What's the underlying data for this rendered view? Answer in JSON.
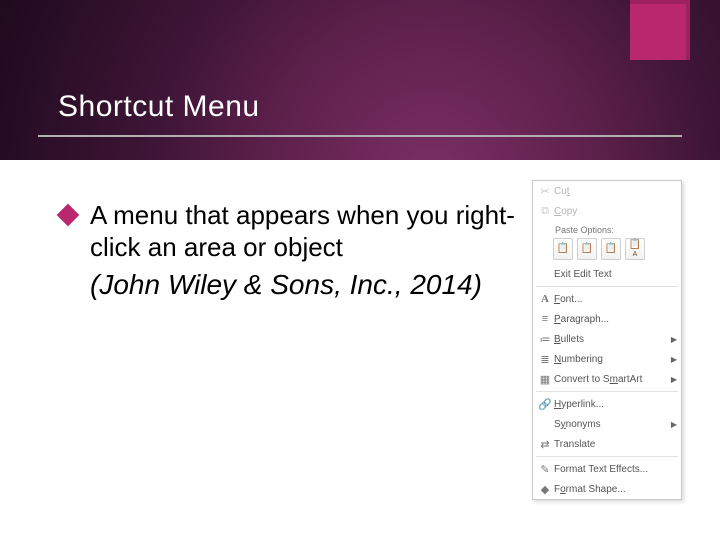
{
  "header": {
    "title": "Shortcut Menu"
  },
  "body": {
    "bullet_text": "A menu that appears when you right-click an area or object",
    "citation": "(John Wiley & Sons, Inc., 2014)"
  },
  "context_menu": {
    "paste_options_label": "Paste Options:",
    "paste_buttons": [
      "keep-source",
      "merge",
      "picture",
      "text-only"
    ],
    "items": [
      {
        "icon": "✂",
        "label": "Cut",
        "underline": "t",
        "enabled": false,
        "submenu": false
      },
      {
        "icon": "⧉",
        "label": "Copy",
        "underline": "C",
        "enabled": false,
        "submenu": false
      },
      {
        "type": "paste"
      },
      {
        "icon": "",
        "label": "Exit Edit Text",
        "underline": "",
        "enabled": true,
        "submenu": false
      },
      {
        "type": "sep"
      },
      {
        "icon": "A",
        "label": "Font...",
        "underline": "F",
        "enabled": true,
        "submenu": false,
        "iconClass": "ico-font"
      },
      {
        "icon": "≡",
        "label": "Paragraph...",
        "underline": "P",
        "enabled": true,
        "submenu": false
      },
      {
        "icon": "≔",
        "label": "Bullets",
        "underline": "B",
        "enabled": true,
        "submenu": true
      },
      {
        "icon": "≣",
        "label": "Numbering",
        "underline": "N",
        "enabled": true,
        "submenu": true
      },
      {
        "icon": "▦",
        "label": "Convert to SmartArt",
        "underline": "m",
        "enabled": true,
        "submenu": true
      },
      {
        "type": "sep"
      },
      {
        "icon": "🔗",
        "label": "Hyperlink...",
        "underline": "H",
        "enabled": true,
        "submenu": false
      },
      {
        "icon": "",
        "label": "Synonyms",
        "underline": "y",
        "enabled": true,
        "submenu": true
      },
      {
        "icon": "⇄",
        "label": "Translate",
        "underline": "",
        "enabled": true,
        "submenu": false
      },
      {
        "type": "sep"
      },
      {
        "icon": "✎",
        "label": "Format Text Effects...",
        "underline": "",
        "enabled": true,
        "submenu": false
      },
      {
        "icon": "◆",
        "label": "Format Shape...",
        "underline": "o",
        "enabled": true,
        "submenu": false
      }
    ]
  }
}
